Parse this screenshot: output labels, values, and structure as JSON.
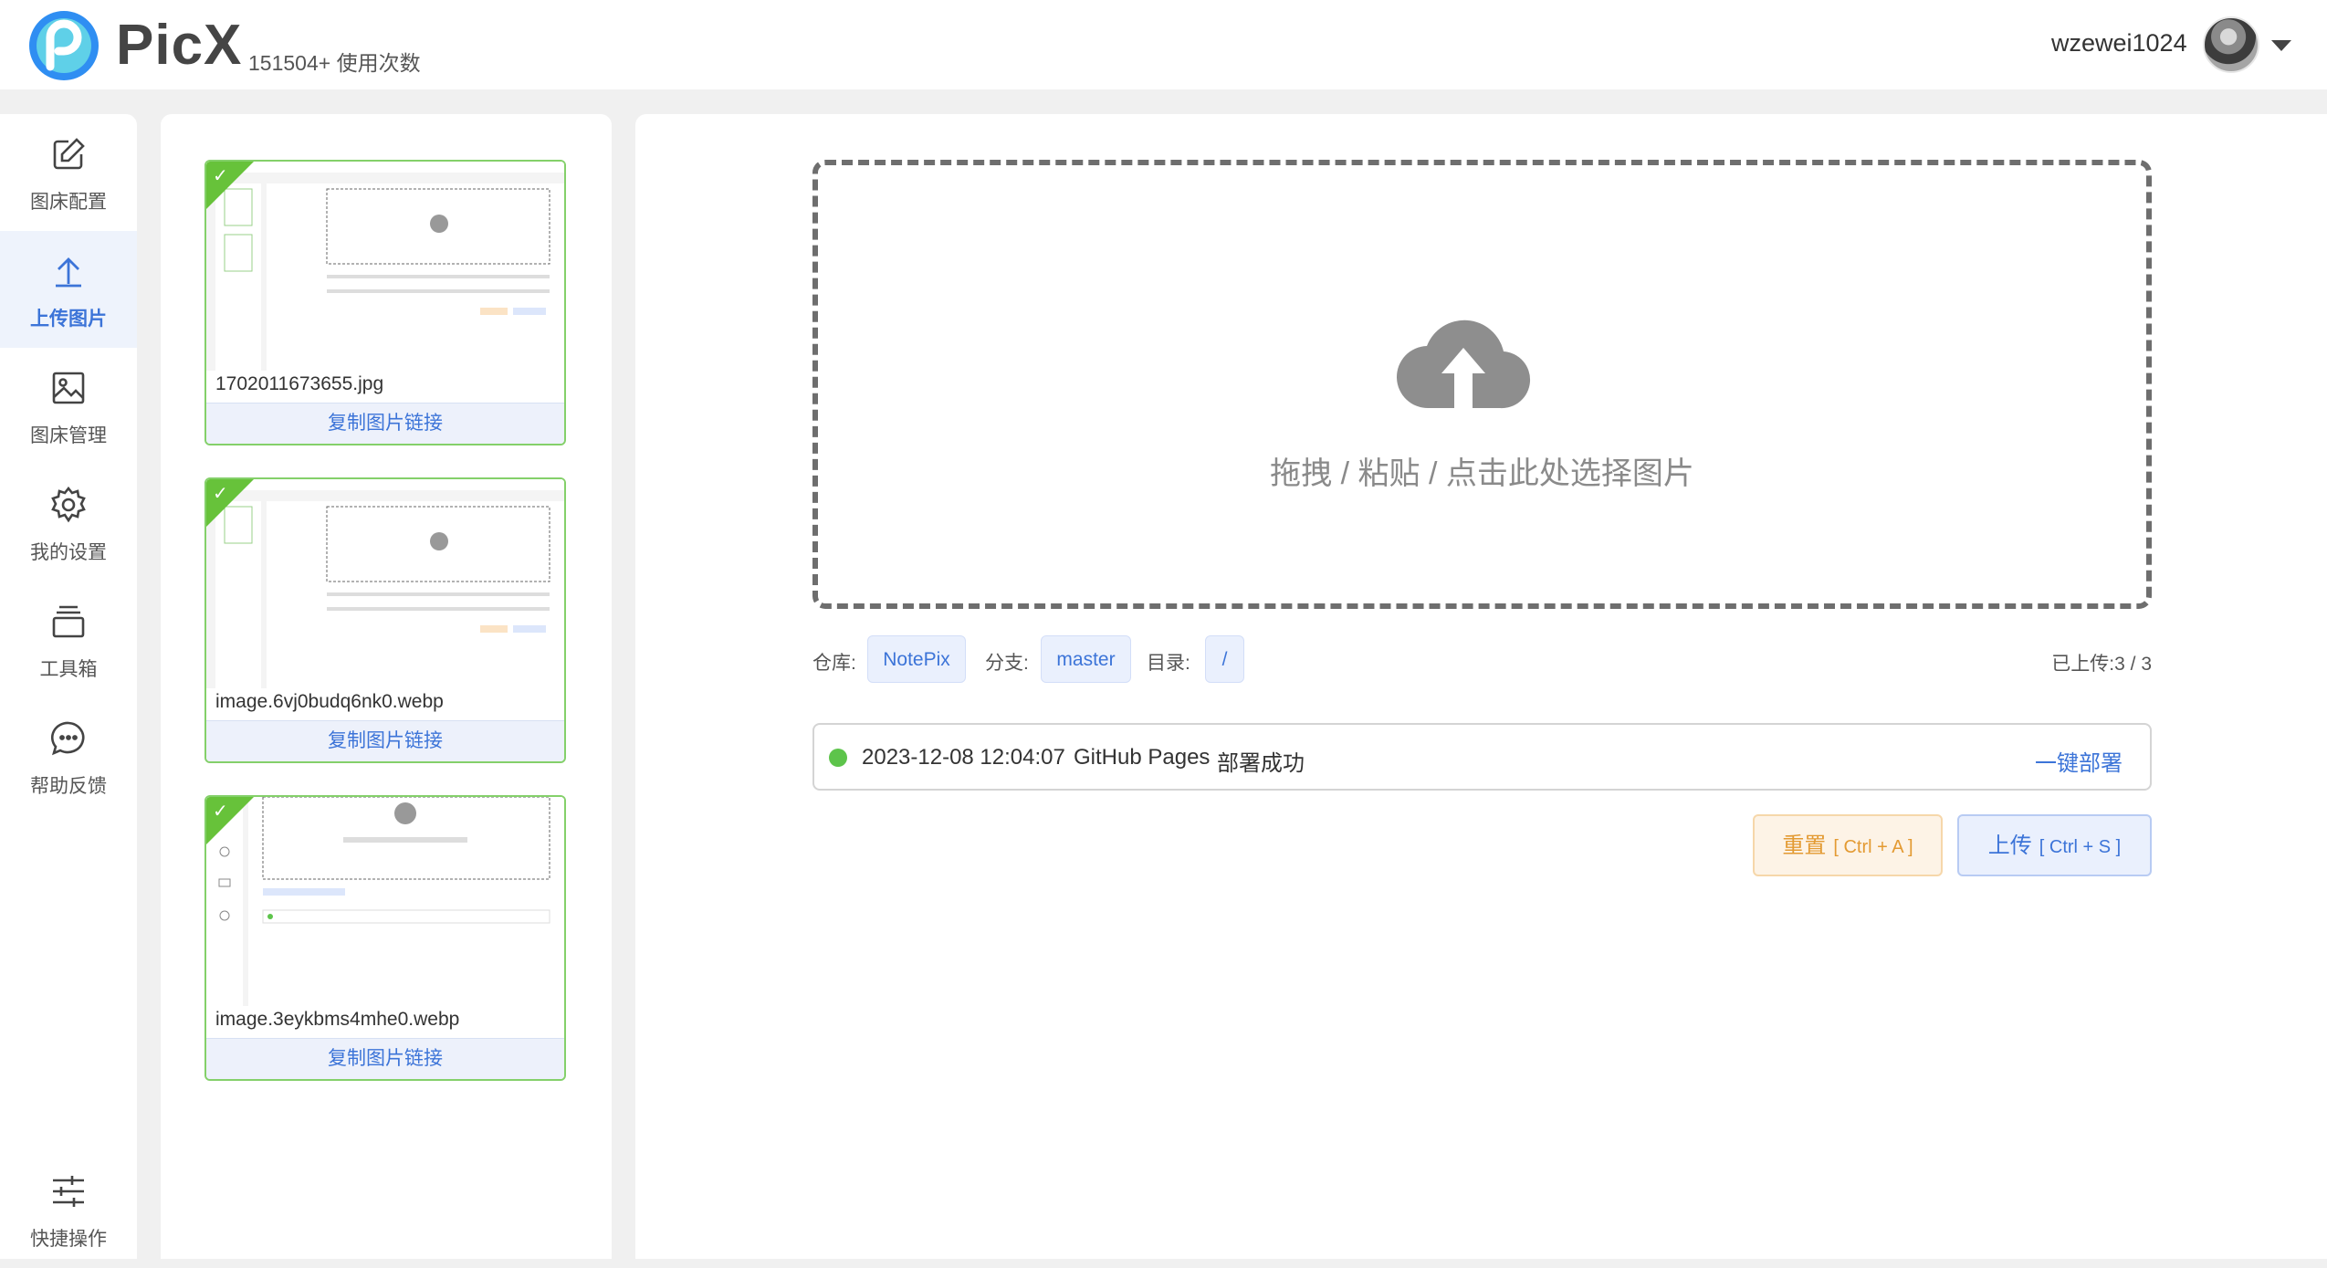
{
  "header": {
    "brand": "PicX",
    "usage": "151504+ 使用次数",
    "username": "wzewei1024"
  },
  "nav": {
    "items": [
      {
        "label": "图床配置",
        "icon": "edit-icon"
      },
      {
        "label": "上传图片",
        "icon": "upload-icon",
        "active": true
      },
      {
        "label": "图床管理",
        "icon": "image-icon"
      },
      {
        "label": "我的设置",
        "icon": "gear-icon"
      },
      {
        "label": "工具箱",
        "icon": "toolbox-icon"
      },
      {
        "label": "帮助反馈",
        "icon": "chat-icon"
      }
    ],
    "bottom": {
      "label": "快捷操作",
      "icon": "sliders-icon"
    }
  },
  "uploads": [
    {
      "filename": "1702011673655.jpg",
      "copy_label": "复制图片链接"
    },
    {
      "filename": "image.6vj0budq6nk0.webp",
      "copy_label": "复制图片链接"
    },
    {
      "filename": "image.3eykbms4mhe0.webp",
      "copy_label": "复制图片链接"
    }
  ],
  "dropzone": {
    "text": "拖拽 / 粘贴 / 点击此处选择图片"
  },
  "meta": {
    "repo_label": "仓库:",
    "repo": "NotePix",
    "branch_label": "分支:",
    "branch": "master",
    "dir_label": "目录:",
    "dir": "/",
    "uploaded": "已上传:3 / 3"
  },
  "status": {
    "time": "2023-12-08 12:04:07",
    "service": "GitHub Pages",
    "state": "部署成功",
    "action": "一键部署",
    "dot_color": "#5dc44b"
  },
  "actions": {
    "reset_label": "重置",
    "reset_shortcut": "[ Ctrl + A ]",
    "upload_label": "上传",
    "upload_shortcut": "[ Ctrl + S ]"
  },
  "colors": {
    "accent": "#3c74d8",
    "success": "#67c23a",
    "warning": "#e39a32"
  }
}
